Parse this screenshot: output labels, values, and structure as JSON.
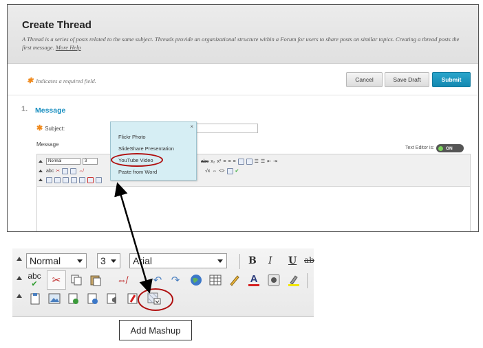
{
  "page": {
    "title": "Create Thread",
    "description": "A Thread is a series of posts related to the same subject. Threads provide an organizational structure within a Forum for users to share posts on similar topics. Creating a thread posts the first message.",
    "more_help": "More Help",
    "required_note": "Indicates a required field.",
    "required_marker": "✱"
  },
  "actions": {
    "cancel": "Cancel",
    "save_draft": "Save Draft",
    "submit": "Submit"
  },
  "section": {
    "number": "1.",
    "title": "Message"
  },
  "form": {
    "subject_label": "Subject:",
    "message_label": "Message",
    "text_editor_label": "Text Editor is:",
    "text_editor_state": "ON"
  },
  "editor_small": {
    "paragraph_select": "Normal",
    "size_select": "3"
  },
  "mashup_popup": {
    "close": "×",
    "items": [
      {
        "label": "Flickr Photo"
      },
      {
        "label": "SlideShare Presentation"
      },
      {
        "label": "YouTube Video"
      },
      {
        "label": "Paste from Word"
      }
    ],
    "highlighted": "YouTube Video"
  },
  "zoomed_toolbar": {
    "paragraph_select": "Normal",
    "size_select": "3",
    "font_select": "Arial",
    "bold": "B",
    "italic": "I",
    "underline": "U",
    "strikethrough": "ab",
    "spellcheck": "abc"
  },
  "caption": "Add Mashup",
  "colors": {
    "accent": "#1a8fc0",
    "submit": "#1488b0",
    "required": "#f08a1d",
    "highlight_oval": "#b01010",
    "popup_bg": "#d6eef4"
  }
}
